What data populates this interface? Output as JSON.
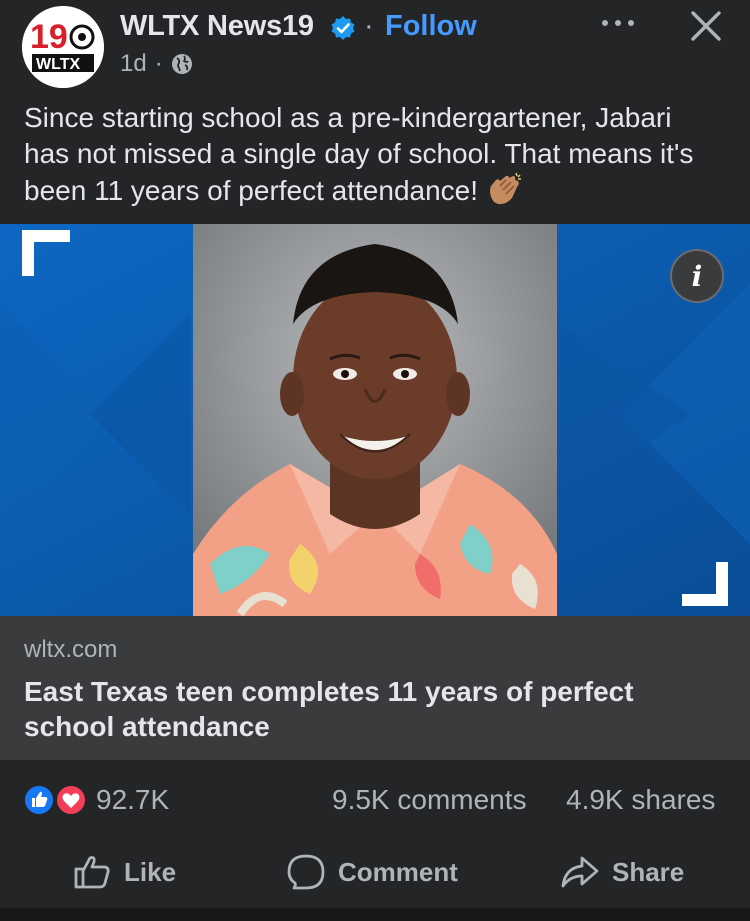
{
  "post": {
    "page_name": "WLTX News19",
    "follow_label": "Follow",
    "separator": "·",
    "time": "1d",
    "time_separator": "·",
    "caption": "Since starting school as a pre-kindergartener, Jabari has not missed a single day of school. That means it's been 11 years of perfect attendance!",
    "avatar_logo_text": "19 WLTX"
  },
  "icons": {
    "verified": "verified-badge-icon",
    "globe": "globe-icon",
    "more": "more-options-icon",
    "close": "close-icon",
    "info": "info-icon",
    "clap": "clapping-hands-emoji"
  },
  "link_preview": {
    "domain": "wltx.com",
    "title": "East Texas teen completes 11 years of perfect school attendance"
  },
  "stats": {
    "reactions_count": "92.7K",
    "comments": "9.5K comments",
    "shares": "4.9K shares"
  },
  "actions": {
    "like": "Like",
    "comment": "Comment",
    "share": "Share"
  },
  "colors": {
    "background": "#242526",
    "link_card": "#3a3b3c",
    "accent": "#4599ff",
    "brand_blue": "#0f5aa6",
    "like_blue": "#1877f2",
    "love_red": "#f33e58"
  }
}
